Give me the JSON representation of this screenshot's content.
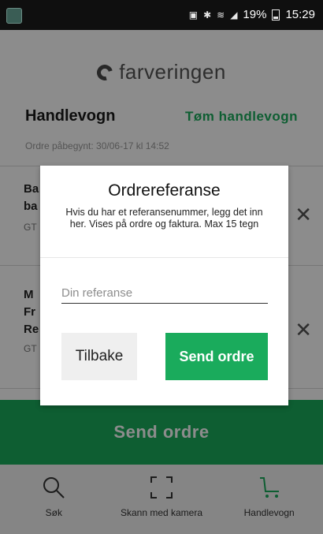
{
  "status_bar": {
    "battery": "19%",
    "time": "15:29"
  },
  "app": {
    "logo_text": "farveringen",
    "cart_title": "Handlevogn",
    "empty_cart_label": "Tøm handlevogn",
    "order_started": "Ordre påbegynt: 30/06-17 kl 14:52",
    "items": [
      {
        "line1": "Ba",
        "line2": "ba",
        "line3": "",
        "gtin": "GT"
      },
      {
        "line1": "M",
        "line2": "Fr",
        "line3": "Re",
        "gtin": "GT"
      }
    ],
    "send_order_label": "Send ordre",
    "tabs": [
      {
        "label": "Søk",
        "icon": "search-icon"
      },
      {
        "label": "Skann med kamera",
        "icon": "scan-icon"
      },
      {
        "label": "Handlevogn",
        "icon": "cart-icon"
      }
    ]
  },
  "dialog": {
    "title": "Ordrereferanse",
    "body": "Hvis du har et referansenummer, legg det inn her. Vises på ordre og faktura. Max 15 tegn",
    "input_placeholder": "Din referanse",
    "input_value": "",
    "back_label": "Tilbake",
    "send_label": "Send ordre"
  },
  "colors": {
    "accent": "#1aab5c",
    "statusbar": "#0f0f0f"
  }
}
